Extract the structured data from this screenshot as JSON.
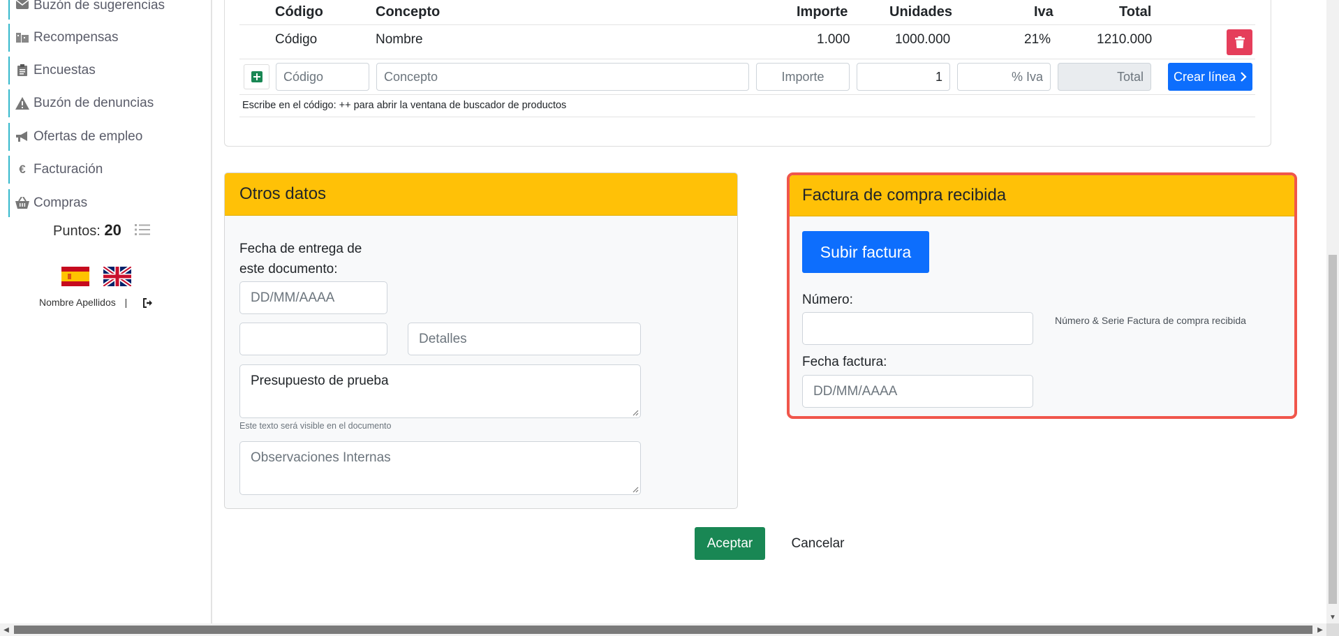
{
  "sidebar": {
    "items": [
      {
        "label": "Buzón de sugerencias",
        "icon": "envelope-icon"
      },
      {
        "label": "Recompensas",
        "icon": "building-icon"
      },
      {
        "label": "Encuestas",
        "icon": "clipboard-icon"
      },
      {
        "label": "Buzón de denuncias",
        "icon": "warning-icon"
      },
      {
        "label": "Ofertas de empleo",
        "icon": "megaphone-icon"
      },
      {
        "label": "Facturación",
        "icon": "euro-icon"
      },
      {
        "label": "Compras",
        "icon": "basket-icon"
      }
    ],
    "points_label": "Puntos:",
    "points_value": "20",
    "user_name": "Nombre Apellidos",
    "separator": "|"
  },
  "lines": {
    "headers": {
      "codigo": "Código",
      "concepto": "Concepto",
      "importe": "Importe",
      "unidades": "Unidades",
      "iva": "Iva",
      "total": "Total"
    },
    "row": {
      "codigo": "Código",
      "concepto": "Nombre",
      "importe": "1.000",
      "unidades": "1000.000",
      "iva": "21%",
      "total": "1210.000"
    },
    "new_line": {
      "codigo_placeholder": "Código",
      "concepto_placeholder": "Concepto",
      "importe_placeholder": "Importe",
      "unidades_value": "1",
      "iva_placeholder": "% Iva",
      "total_placeholder": "Total",
      "create_label": "Crear línea"
    },
    "hint": "Escribe en el código: ++ para abrir la ventana de buscador de productos"
  },
  "otros": {
    "title": "Otros datos",
    "fecha_label_1": "Fecha de entrega de",
    "fecha_label_2": "este documento:",
    "fecha_placeholder": "DD/MM/AAAA",
    "detalles_placeholder": "Detalles",
    "presupuesto_text": "Presupuesto de prueba",
    "visible_note": "Este texto será visible en el documento",
    "observaciones_placeholder": "Observaciones Internas"
  },
  "factura": {
    "title": "Factura de compra recibida",
    "upload_label": "Subir factura",
    "numero_label": "Número:",
    "numero_help": "Número & Serie Factura de compra recibida",
    "fecha_label": "Fecha factura:",
    "fecha_placeholder": "DD/MM/AAAA"
  },
  "actions": {
    "accept": "Aceptar",
    "cancel": "Cancelar"
  },
  "colors": {
    "card_header": "#ffc107",
    "primary": "#0d6efd",
    "success": "#198754",
    "danger": "#e53e5b",
    "highlight_border": "#f0564b"
  }
}
